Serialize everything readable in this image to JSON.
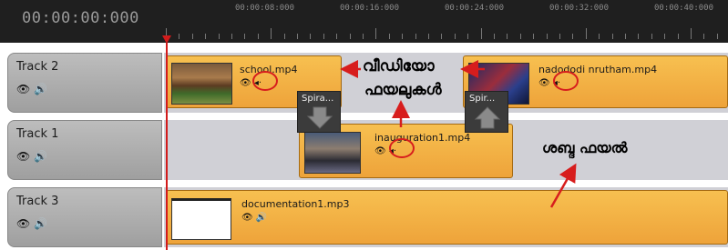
{
  "ruler": {
    "timecode": "00:00:00:000",
    "marks": [
      "00:00:08:000",
      "00:00:16:000",
      "00:00:24:000",
      "00:00:32:000",
      "00:00:40:000"
    ]
  },
  "tracks": [
    {
      "name": "Track 2",
      "visibility_icon": "eye-icon",
      "audio_icon": "speaker-icon"
    },
    {
      "name": "Track 1",
      "visibility_icon": "eye-icon",
      "audio_icon": "speaker-icon"
    },
    {
      "name": "Track 3",
      "visibility_icon": "eye-icon",
      "audio_icon": "speaker-icon"
    }
  ],
  "clips": {
    "school": {
      "name": "school.mp4",
      "track": "Track 2"
    },
    "nadodi": {
      "name": "nadododi nrutham.mp4",
      "track": "Track 2"
    },
    "inauguration": {
      "name": "inauguration1.mp4",
      "track": "Track 1"
    },
    "documentation": {
      "name": "documentation1.mp3",
      "track": "Track 3"
    }
  },
  "transitions": [
    {
      "label": "Spira...",
      "direction": "down"
    },
    {
      "label": "Spir...",
      "direction": "up"
    }
  ],
  "annotations": {
    "video_files_line1": "വീഡിയോ",
    "video_files_line2": "ഫയലുകൾ",
    "audio_file": "ശബ്ദ ഫയൽ"
  },
  "colors": {
    "clip": "#f0a93a",
    "playhead": "#d21b1b",
    "annotation": "#d71d1d"
  }
}
